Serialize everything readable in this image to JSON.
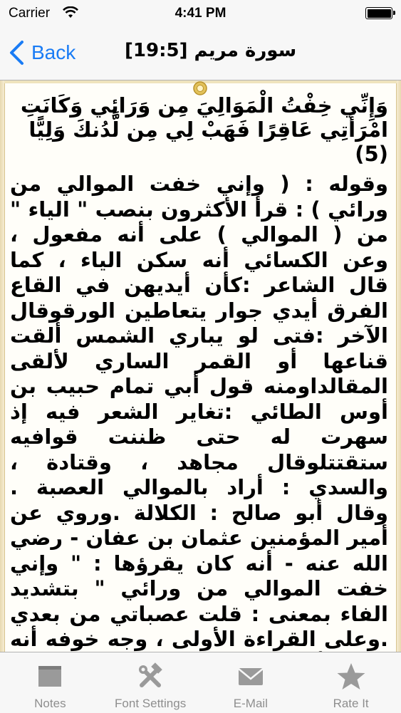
{
  "status_bar": {
    "carrier": "Carrier",
    "time": "4:41 PM"
  },
  "nav": {
    "back_label": "Back",
    "title": "سورة مريم [19:5]"
  },
  "verse": "وَإِنِّي خِفْتُ الْمَوَالِيَ مِن وَرَائِي وَكَانَتِ امْرَأَتِي عَاقِرًا فَهَبْ لِي مِن لَّدُنكَ وَلِيًّا (5)",
  "tafsir": "وقوله : ( وإني خفت الموالي من ورائي ) : قرأ الأكثرون بنصب \" الياء \" من ( الموالي ) على أنه مفعول ، وعن الكسائي أنه سكن الياء ، كما قال الشاعر :كأن أيديهن في القاع الفرق أيدي جوار يتعاطين الورقوقال الآخر :فتى لو يباري الشمس ألقت قناعها     أو القمر الساري لألقى المقالداومنه قول أبي تمام حبيب بن أوس الطائي :تغاير الشعر فيه إذ سهرت له حتى ظننت قوافيه ستقتتلوقال مجاهد ، وقتادة ، والسدي : أراد بالموالي العصبة . وقال أبو صالح : الكلالة .وروي عن أمير المؤمنين عثمان بن عفان - رضي الله عنه - أنه كان يقرؤها : \" وإني خفت الموالي من ورائي \" بتشديد الفاء بمعنى : قلت عصباتي من بعدي .وعلى القراءة الأولى ، وجه خوفه أنه خشي أن يتصرفوا من بعده في الناس تصرفا سيئا",
  "tabs": [
    {
      "label": "Notes",
      "icon": "notes-icon"
    },
    {
      "label": "Font Settings",
      "icon": "tools-icon"
    },
    {
      "label": "E-Mail",
      "icon": "envelope-icon"
    },
    {
      "label": "Rate It",
      "icon": "star-icon"
    }
  ],
  "colors": {
    "accent": "#1a7cf5",
    "tab_inactive": "#8e8e8e",
    "page_border": "#e8d9b0"
  }
}
